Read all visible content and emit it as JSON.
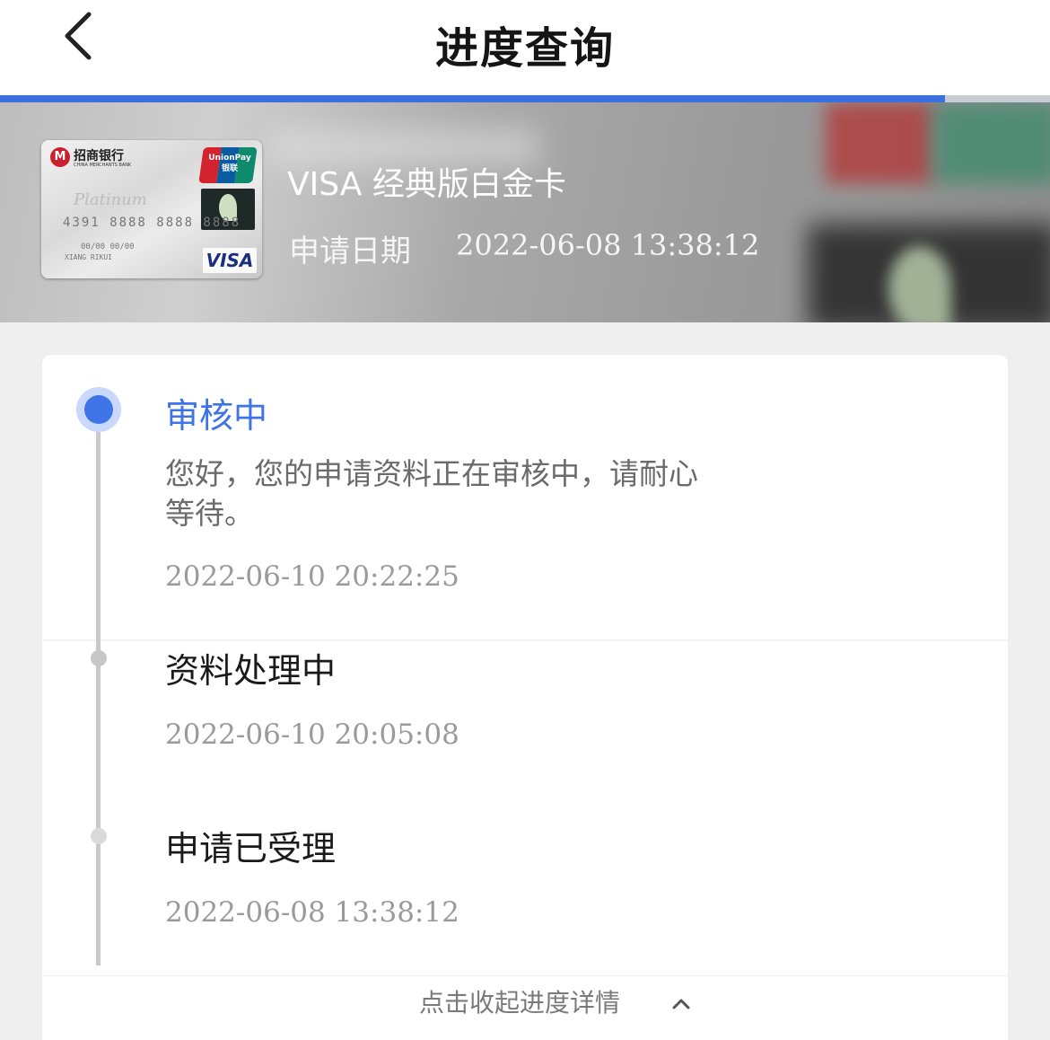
{
  "header": {
    "title": "进度查询",
    "progress_fraction": 0.9
  },
  "card": {
    "bank_name": "招商银行",
    "bank_name_en": "CHINA MERCHANTS BANK",
    "tier_text": "Platinum",
    "unionpay_text": "UnionPay 银联",
    "number": "4391 8888 8888 8888",
    "expiry": "00/00  00/00",
    "holder": "XIANG RIKUI",
    "network": "VISA"
  },
  "banner": {
    "card_title": "VISA 经典版白金卡",
    "apply_label": "申请日期",
    "apply_date": "2022-06-08 13:38:12"
  },
  "timeline": {
    "steps": [
      {
        "title": "审核中",
        "desc": "您好，您的申请资料正在审核中，请耐心等待。",
        "time": "2022-06-10 20:22:25",
        "active": true
      },
      {
        "title": "资料处理中",
        "time": "2022-06-10 20:05:08",
        "active": false
      },
      {
        "title": "申请已受理",
        "time": "2022-06-08 13:38:12",
        "active": false
      }
    ]
  },
  "footer": {
    "collapse_label": "点击收起进度详情"
  },
  "colors": {
    "accent": "#3f73e8",
    "progress": "#3d6fe0",
    "muted_text": "#9a9a9a"
  },
  "icons": {
    "back": "chevron-left-icon",
    "collapse": "chevron-up-icon"
  }
}
